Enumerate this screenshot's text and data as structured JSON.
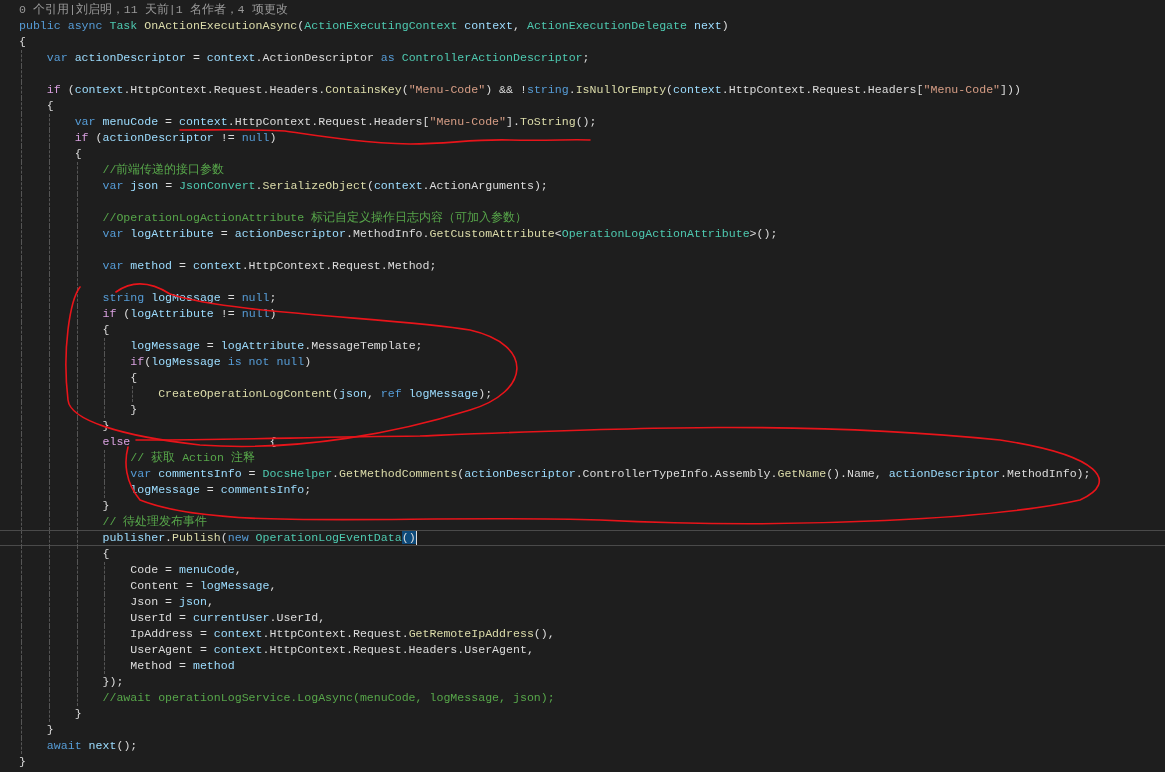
{
  "editor": {
    "codelens": "0 个引用|刘启明，11 天前|1 名作者，4 项更改",
    "lines": [
      {
        "kind": "code",
        "tokens": [
          {
            "kind": "keyword",
            "text": "public async "
          },
          {
            "kind": "type",
            "text": "Task"
          },
          {
            "kind": "method",
            "text": " OnActionExecutionAsync"
          },
          {
            "kind": "plain",
            "text": "("
          },
          {
            "kind": "type",
            "text": "ActionExecutingContext"
          },
          {
            "kind": "variable",
            "text": " context"
          },
          {
            "kind": "plain",
            "text": ", "
          },
          {
            "kind": "type",
            "text": "ActionExecutionDelegate"
          },
          {
            "kind": "variable",
            "text": " next"
          },
          {
            "kind": "plain",
            "text": ")"
          }
        ]
      },
      {
        "kind": "code",
        "tokens": [
          {
            "kind": "plain",
            "text": "{"
          }
        ]
      },
      {
        "kind": "code",
        "tokens": [
          {
            "kind": "keyword",
            "text": "    var"
          },
          {
            "kind": "variable",
            "text": " actionDescriptor"
          },
          {
            "kind": "plain",
            "text": " = "
          },
          {
            "kind": "variable",
            "text": "context"
          },
          {
            "kind": "plain",
            "text": ".ActionDescriptor "
          },
          {
            "kind": "keyword",
            "text": "as"
          },
          {
            "kind": "type",
            "text": " ControllerActionDescriptor"
          },
          {
            "kind": "plain",
            "text": ";"
          }
        ]
      },
      {
        "kind": "blank"
      },
      {
        "kind": "code",
        "tokens": [
          {
            "kind": "control",
            "text": "    if"
          },
          {
            "kind": "plain",
            "text": " ("
          },
          {
            "kind": "variable",
            "text": "context"
          },
          {
            "kind": "plain",
            "text": ".HttpContext.Request.Headers."
          },
          {
            "kind": "method",
            "text": "ContainsKey"
          },
          {
            "kind": "plain",
            "text": "("
          },
          {
            "kind": "string",
            "text": "\"Menu-Code\""
          },
          {
            "kind": "plain",
            "text": ") && !"
          },
          {
            "kind": "keyword",
            "text": "string"
          },
          {
            "kind": "plain",
            "text": "."
          },
          {
            "kind": "method",
            "text": "IsNullOrEmpty"
          },
          {
            "kind": "plain",
            "text": "("
          },
          {
            "kind": "variable",
            "text": "context"
          },
          {
            "kind": "plain",
            "text": ".HttpContext.Request.Headers["
          },
          {
            "kind": "string",
            "text": "\"Menu-Code\""
          },
          {
            "kind": "plain",
            "text": "]))"
          }
        ]
      },
      {
        "kind": "code",
        "tokens": [
          {
            "kind": "plain",
            "text": "    {"
          }
        ]
      },
      {
        "kind": "code",
        "tokens": [
          {
            "kind": "keyword",
            "text": "        var"
          },
          {
            "kind": "variable",
            "text": " menuCode"
          },
          {
            "kind": "plain",
            "text": " = "
          },
          {
            "kind": "variable",
            "text": "context"
          },
          {
            "kind": "plain",
            "text": ".HttpContext.Request.Headers["
          },
          {
            "kind": "string",
            "text": "\"Menu-Code\""
          },
          {
            "kind": "plain",
            "text": "]."
          },
          {
            "kind": "method",
            "text": "ToString"
          },
          {
            "kind": "plain",
            "text": "();"
          }
        ]
      },
      {
        "kind": "code",
        "tokens": [
          {
            "kind": "control",
            "text": "        if"
          },
          {
            "kind": "plain",
            "text": " ("
          },
          {
            "kind": "variable",
            "text": "actionDescriptor"
          },
          {
            "kind": "plain",
            "text": " != "
          },
          {
            "kind": "keyword",
            "text": "null"
          },
          {
            "kind": "plain",
            "text": ")"
          }
        ]
      },
      {
        "kind": "code",
        "tokens": [
          {
            "kind": "plain",
            "text": "        {"
          }
        ]
      },
      {
        "kind": "code",
        "tokens": [
          {
            "kind": "comment",
            "text": "            //前端传递的接口参数"
          }
        ]
      },
      {
        "kind": "code",
        "tokens": [
          {
            "kind": "keyword",
            "text": "            var"
          },
          {
            "kind": "variable",
            "text": " json"
          },
          {
            "kind": "plain",
            "text": " = "
          },
          {
            "kind": "type",
            "text": "JsonConvert"
          },
          {
            "kind": "plain",
            "text": "."
          },
          {
            "kind": "method",
            "text": "SerializeObject"
          },
          {
            "kind": "plain",
            "text": "("
          },
          {
            "kind": "variable",
            "text": "context"
          },
          {
            "kind": "plain",
            "text": ".ActionArguments);"
          }
        ]
      },
      {
        "kind": "blank"
      },
      {
        "kind": "code",
        "tokens": [
          {
            "kind": "comment",
            "text": "            //OperationLogActionAttribute 标记自定义操作日志内容（可加入参数）"
          }
        ]
      },
      {
        "kind": "code",
        "tokens": [
          {
            "kind": "keyword",
            "text": "            var"
          },
          {
            "kind": "variable",
            "text": " logAttribute"
          },
          {
            "kind": "plain",
            "text": " = "
          },
          {
            "kind": "variable",
            "text": "actionDescriptor"
          },
          {
            "kind": "plain",
            "text": ".MethodInfo."
          },
          {
            "kind": "method",
            "text": "GetCustomAttribute"
          },
          {
            "kind": "plain",
            "text": "<"
          },
          {
            "kind": "type",
            "text": "OperationLogActionAttribute"
          },
          {
            "kind": "plain",
            "text": ">();"
          }
        ]
      },
      {
        "kind": "blank"
      },
      {
        "kind": "code",
        "tokens": [
          {
            "kind": "keyword",
            "text": "            var"
          },
          {
            "kind": "variable",
            "text": " method"
          },
          {
            "kind": "plain",
            "text": " = "
          },
          {
            "kind": "variable",
            "text": "context"
          },
          {
            "kind": "plain",
            "text": ".HttpContext.Request.Method;"
          }
        ]
      },
      {
        "kind": "blank"
      },
      {
        "kind": "code",
        "tokens": [
          {
            "kind": "keyword",
            "text": "            string"
          },
          {
            "kind": "variable",
            "text": " logMessage"
          },
          {
            "kind": "plain",
            "text": " = "
          },
          {
            "kind": "keyword",
            "text": "null"
          },
          {
            "kind": "plain",
            "text": ";"
          }
        ]
      },
      {
        "kind": "code",
        "tokens": [
          {
            "kind": "control",
            "text": "            if"
          },
          {
            "kind": "plain",
            "text": " ("
          },
          {
            "kind": "variable",
            "text": "logAttribute"
          },
          {
            "kind": "plain",
            "text": " != "
          },
          {
            "kind": "keyword",
            "text": "null"
          },
          {
            "kind": "plain",
            "text": ")"
          }
        ]
      },
      {
        "kind": "code",
        "tokens": [
          {
            "kind": "plain",
            "text": "            {"
          }
        ]
      },
      {
        "kind": "code",
        "tokens": [
          {
            "kind": "variable",
            "text": "                logMessage"
          },
          {
            "kind": "plain",
            "text": " = "
          },
          {
            "kind": "variable",
            "text": "logAttribute"
          },
          {
            "kind": "plain",
            "text": ".MessageTemplate;"
          }
        ]
      },
      {
        "kind": "code",
        "tokens": [
          {
            "kind": "control",
            "text": "                if"
          },
          {
            "kind": "plain",
            "text": "("
          },
          {
            "kind": "variable",
            "text": "logMessage"
          },
          {
            "kind": "keyword",
            "text": " is not null"
          },
          {
            "kind": "plain",
            "text": ")"
          }
        ]
      },
      {
        "kind": "code",
        "tokens": [
          {
            "kind": "plain",
            "text": "                {"
          }
        ]
      },
      {
        "kind": "code",
        "tokens": [
          {
            "kind": "method",
            "text": "                    CreateOperationLogContent"
          },
          {
            "kind": "plain",
            "text": "("
          },
          {
            "kind": "variable",
            "text": "json"
          },
          {
            "kind": "plain",
            "text": ", "
          },
          {
            "kind": "keyword",
            "text": "ref"
          },
          {
            "kind": "variable",
            "text": " logMessage"
          },
          {
            "kind": "plain",
            "text": ");"
          }
        ]
      },
      {
        "kind": "code",
        "tokens": [
          {
            "kind": "plain",
            "text": "                }"
          }
        ]
      },
      {
        "kind": "code",
        "tokens": [
          {
            "kind": "plain",
            "text": "            }"
          }
        ]
      },
      {
        "kind": "code",
        "tokens": [
          {
            "kind": "control",
            "text": "            else"
          },
          {
            "kind": "plain",
            "text": "                    {"
          }
        ]
      },
      {
        "kind": "code",
        "tokens": [
          {
            "kind": "comment",
            "text": "                // 获取 Action 注释"
          }
        ]
      },
      {
        "kind": "code",
        "tokens": [
          {
            "kind": "keyword",
            "text": "                var"
          },
          {
            "kind": "variable",
            "text": " commentsInfo"
          },
          {
            "kind": "plain",
            "text": " = "
          },
          {
            "kind": "type",
            "text": "DocsHelper"
          },
          {
            "kind": "plain",
            "text": "."
          },
          {
            "kind": "method",
            "text": "GetMethodComments"
          },
          {
            "kind": "plain",
            "text": "("
          },
          {
            "kind": "variable",
            "text": "actionDescriptor"
          },
          {
            "kind": "plain",
            "text": ".ControllerTypeInfo.Assembly."
          },
          {
            "kind": "method",
            "text": "GetName"
          },
          {
            "kind": "plain",
            "text": "().Name, "
          },
          {
            "kind": "variable",
            "text": "actionDescriptor"
          },
          {
            "kind": "plain",
            "text": ".MethodInfo);"
          }
        ]
      },
      {
        "kind": "code",
        "tokens": [
          {
            "kind": "variable",
            "text": "                logMessage"
          },
          {
            "kind": "plain",
            "text": " = "
          },
          {
            "kind": "variable",
            "text": "commentsInfo"
          },
          {
            "kind": "plain",
            "text": ";"
          }
        ]
      },
      {
        "kind": "code",
        "tokens": [
          {
            "kind": "plain",
            "text": "            }"
          }
        ]
      },
      {
        "kind": "code",
        "tokens": [
          {
            "kind": "comment",
            "text": "            // 待处理发布事件"
          }
        ]
      },
      {
        "kind": "code",
        "current": true,
        "tokens": [
          {
            "kind": "variable",
            "text": "            publisher"
          },
          {
            "kind": "plain",
            "text": "."
          },
          {
            "kind": "method",
            "text": "Publish"
          },
          {
            "kind": "plain",
            "text": "("
          },
          {
            "kind": "keyword",
            "text": "new"
          },
          {
            "kind": "type",
            "text": " OperationLogEventData"
          },
          {
            "kind": "matched",
            "text": "()"
          }
        ]
      },
      {
        "kind": "code",
        "tokens": [
          {
            "kind": "plain",
            "text": "            {"
          }
        ]
      },
      {
        "kind": "code",
        "tokens": [
          {
            "kind": "plain",
            "text": "                Code = "
          },
          {
            "kind": "variable",
            "text": "menuCode"
          },
          {
            "kind": "plain",
            "text": ","
          }
        ]
      },
      {
        "kind": "code",
        "tokens": [
          {
            "kind": "plain",
            "text": "                Content = "
          },
          {
            "kind": "variable",
            "text": "logMessage"
          },
          {
            "kind": "plain",
            "text": ","
          }
        ]
      },
      {
        "kind": "code",
        "tokens": [
          {
            "kind": "plain",
            "text": "                Json = "
          },
          {
            "kind": "variable",
            "text": "json"
          },
          {
            "kind": "plain",
            "text": ","
          }
        ]
      },
      {
        "kind": "code",
        "tokens": [
          {
            "kind": "plain",
            "text": "                UserId = "
          },
          {
            "kind": "variable",
            "text": "currentUser"
          },
          {
            "kind": "plain",
            "text": ".UserId,"
          }
        ]
      },
      {
        "kind": "code",
        "tokens": [
          {
            "kind": "plain",
            "text": "                IpAddress = "
          },
          {
            "kind": "variable",
            "text": "context"
          },
          {
            "kind": "plain",
            "text": ".HttpContext.Request."
          },
          {
            "kind": "method",
            "text": "GetRemoteIpAddress"
          },
          {
            "kind": "plain",
            "text": "(),"
          }
        ]
      },
      {
        "kind": "code",
        "tokens": [
          {
            "kind": "plain",
            "text": "                UserAgent = "
          },
          {
            "kind": "variable",
            "text": "context"
          },
          {
            "kind": "plain",
            "text": ".HttpContext.Request.Headers.UserAgent,"
          }
        ]
      },
      {
        "kind": "code",
        "tokens": [
          {
            "kind": "plain",
            "text": "                Method = "
          },
          {
            "kind": "variable",
            "text": "method"
          }
        ]
      },
      {
        "kind": "code",
        "tokens": [
          {
            "kind": "plain",
            "text": "            });"
          }
        ]
      },
      {
        "kind": "code",
        "tokens": [
          {
            "kind": "comment",
            "text": "            //await operationLogService.LogAsync(menuCode, logMessage, json);"
          }
        ]
      },
      {
        "kind": "code",
        "tokens": [
          {
            "kind": "plain",
            "text": "        }"
          }
        ]
      },
      {
        "kind": "code",
        "tokens": [
          {
            "kind": "plain",
            "text": "    }"
          }
        ]
      },
      {
        "kind": "code",
        "tokens": [
          {
            "kind": "keyword",
            "text": "    await"
          },
          {
            "kind": "variable",
            "text": " next"
          },
          {
            "kind": "plain",
            "text": "();"
          }
        ]
      },
      {
        "kind": "code",
        "tokens": [
          {
            "kind": "plain",
            "text": "}"
          }
        ]
      }
    ]
  }
}
